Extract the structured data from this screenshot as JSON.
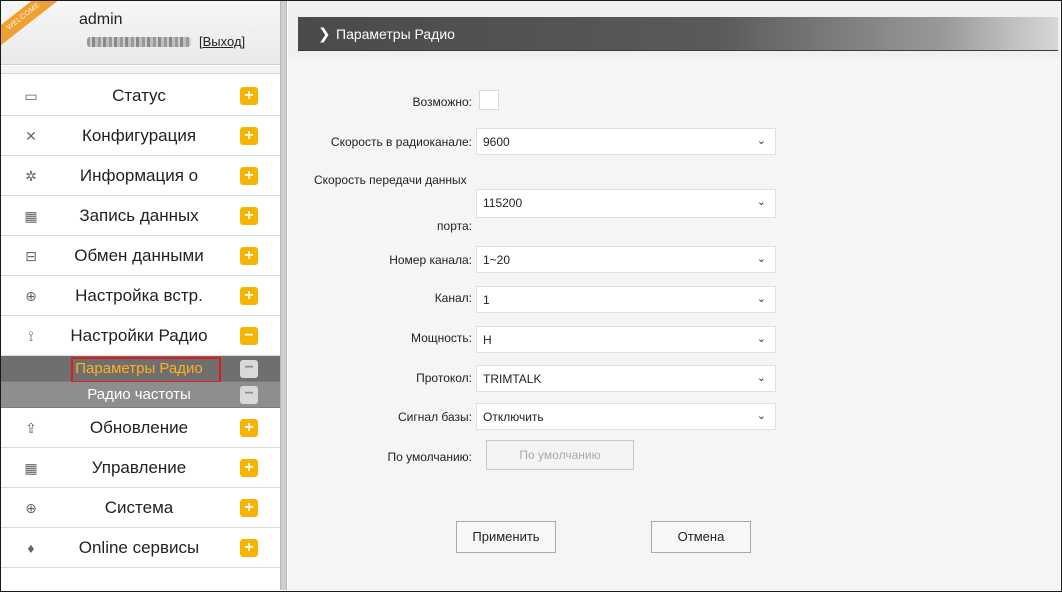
{
  "sidebar": {
    "welcome_badge": "WELCOME",
    "user": "admin",
    "logout_open": "[",
    "logout_label": "Выход",
    "logout_close": "]",
    "menu": [
      {
        "label": "Статус",
        "icon": "monitor-icon",
        "toggle": "+"
      },
      {
        "label": "Конфигурация",
        "icon": "tools-icon",
        "toggle": "+"
      },
      {
        "label": "Информация о",
        "icon": "satellite-icon",
        "toggle": "+"
      },
      {
        "label": "Запись данных",
        "icon": "calendar-icon",
        "toggle": "+"
      },
      {
        "label": "Обмен данными",
        "icon": "network-icon",
        "toggle": "+"
      },
      {
        "label": "Настройка встр.",
        "icon": "globe-icon",
        "toggle": "+"
      },
      {
        "label": "Настройки Радио",
        "icon": "antenna-icon",
        "toggle": "−"
      },
      {
        "label": "Параметры Радио",
        "sub": true,
        "active": true,
        "toggle": "−"
      },
      {
        "label": "Радио частоты",
        "sub": true,
        "toggle": "−"
      },
      {
        "label": "Обновление",
        "icon": "upload-icon",
        "toggle": "+"
      },
      {
        "label": "Управление",
        "icon": "calendar-icon",
        "toggle": "+"
      },
      {
        "label": "Система",
        "icon": "globe-icon",
        "toggle": "+"
      },
      {
        "label": "Online сервисы",
        "icon": "cloud-icon",
        "toggle": "+"
      }
    ]
  },
  "page": {
    "chevron": "❯",
    "title": "Параметры Радио"
  },
  "form": {
    "enabled_label": "Возможно:",
    "enabled_checked": false,
    "air_rate_label": "Скорость в радиоканале:",
    "air_rate_value": "9600",
    "port_rate_label_1": "Скорость передачи данных",
    "port_rate_label_2": "порта:",
    "port_rate_value": "115200",
    "channel_no_label": "Номер канала:",
    "channel_no_value": "1~20",
    "channel_label": "Канал:",
    "channel_value": "1",
    "power_label": "Мощность:",
    "power_value": "H",
    "protocol_label": "Протокол:",
    "protocol_value": "TRIMTALK",
    "base_signal_label": "Сигнал базы:",
    "base_signal_value": "Отключить",
    "default_label": "По умолчанию:",
    "default_button": "По умолчанию",
    "apply_button": "Применить",
    "cancel_button": "Отмена",
    "chevron": "⌄"
  },
  "colors": {
    "accent": "#f4b400",
    "active_text": "#ffb020",
    "highlight_border": "#e01b1b",
    "titlebar": "#4a4a4a"
  }
}
